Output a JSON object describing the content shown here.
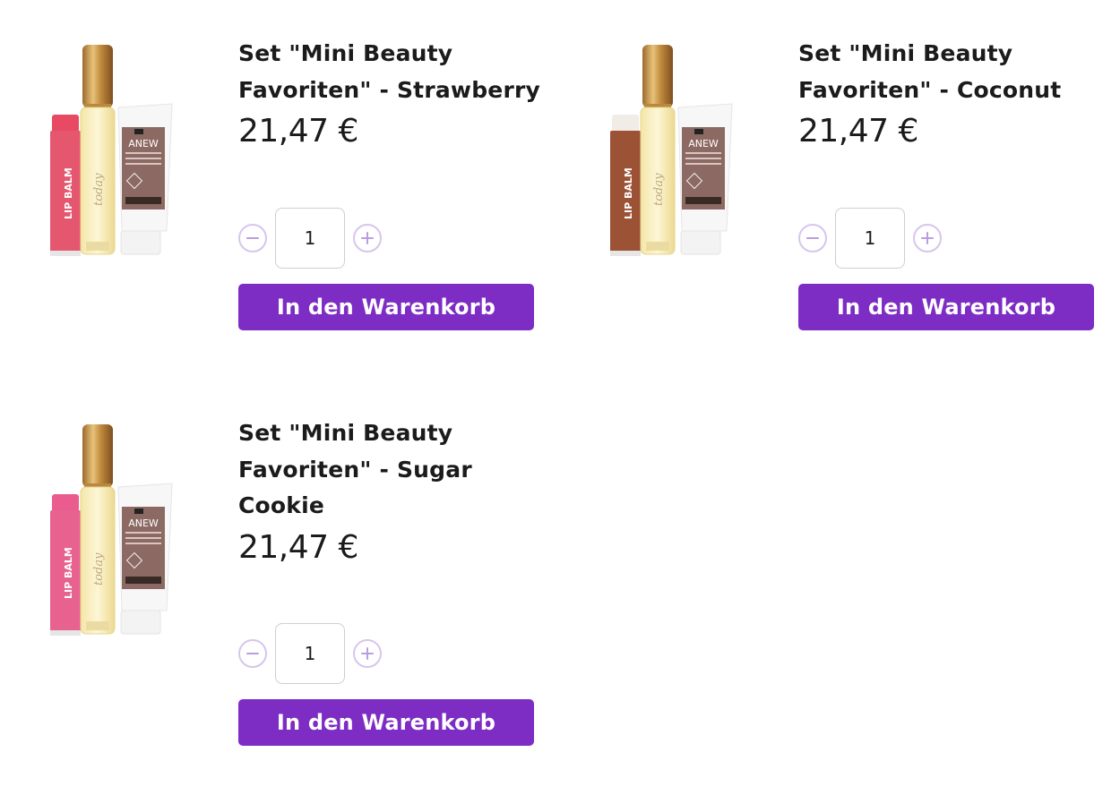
{
  "products": [
    {
      "title": "Set \"Mini Beauty\nFavoriten\" - Strawberry",
      "price": "21,47 €",
      "quantity": "1",
      "add_to_cart_label": "In den Warenkorb",
      "image": {
        "lip_balm_color": "#e5566f",
        "lip_balm_cap_color": "#e84a63",
        "lip_balm_text": "LIP BALM",
        "tube_text": "ANEW"
      }
    },
    {
      "title": "Set \"Mini Beauty\nFavoriten\" - Coconut",
      "price": "21,47 €",
      "quantity": "1",
      "add_to_cart_label": "In den Warenkorb",
      "image": {
        "lip_balm_color": "#9c5235",
        "lip_balm_cap_color": "#f1ece6",
        "lip_balm_text": "LIP BALM",
        "tube_text": "ANEW"
      }
    },
    {
      "title": "Set \"Mini Beauty\nFavoriten\" - Sugar\nCookie",
      "price": "21,47 €",
      "quantity": "1",
      "add_to_cart_label": "In den Warenkorb",
      "image": {
        "lip_balm_color": "#e7628f",
        "lip_balm_cap_color": "#e95c8d",
        "lip_balm_text": "LIP BALM",
        "tube_text": "ANEW"
      }
    }
  ],
  "colors": {
    "button_bg": "#7d2cc4",
    "button_text": "#ffffff",
    "stepper_border": "#d6c6ec",
    "stepper_icon": "#b89ee0"
  },
  "icons": {
    "decrement": "minus-circle-icon",
    "increment": "plus-circle-icon"
  }
}
